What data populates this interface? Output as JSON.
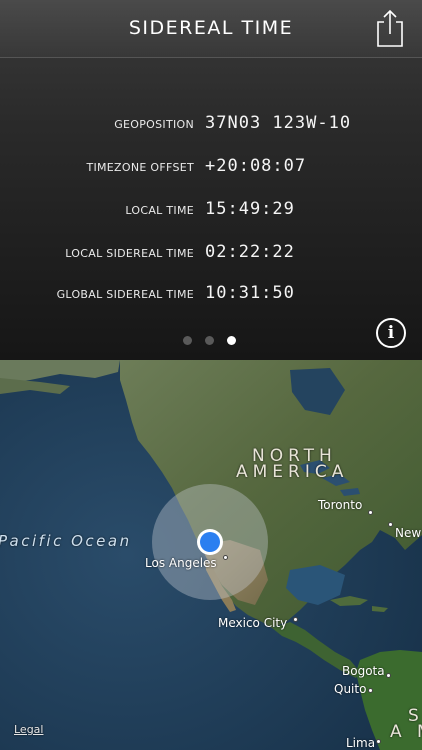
{
  "header": {
    "title": "SIDEREAL TIME",
    "share_icon": "share-icon"
  },
  "rows": [
    {
      "label": "GEOPOSITION",
      "value": "37N03 123W-10"
    },
    {
      "label": "TIMEZONE OFFSET",
      "value": "+20:08:07"
    },
    {
      "label": "LOCAL TIME",
      "value": "15:49:29"
    },
    {
      "label": "LOCAL SIDEREAL TIME",
      "value": "02:22:22"
    },
    {
      "label": "GLOBAL SIDEREAL TIME",
      "value": "10:31:50"
    }
  ],
  "pager": {
    "count": 3,
    "active_index": 2
  },
  "info_button": {
    "glyph": "i"
  },
  "map": {
    "ocean_label": "Pacific Ocean",
    "continent_line1": "NORTH",
    "continent_line2": "AMERICA",
    "south_fragment": "S",
    "south_fragment2": "A M",
    "cities": {
      "toronto": "Toronto",
      "new_york": "New",
      "los_angeles": "Los Angeles",
      "mexico_city": "Mexico City",
      "bogota": "Bogota",
      "quito": "Quito",
      "lima": "Lima"
    },
    "legal": "Legal",
    "location_dot_color": "#2b7ff0"
  }
}
